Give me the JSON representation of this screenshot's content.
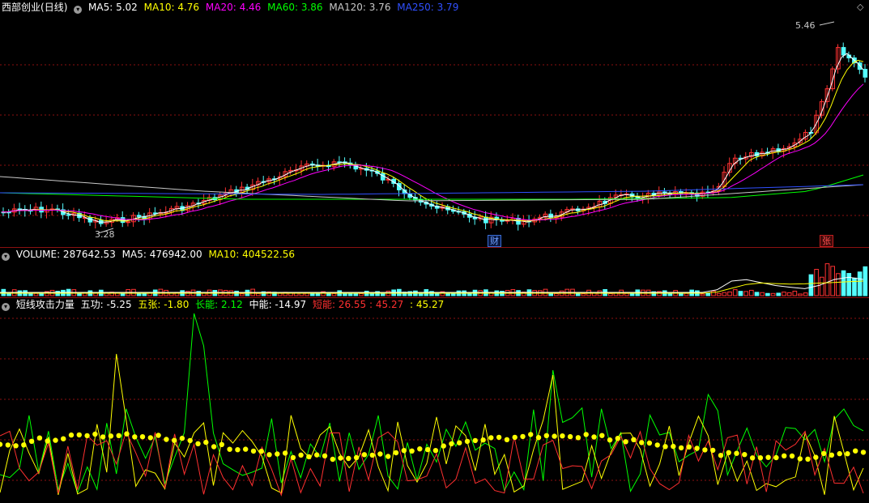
{
  "stock": {
    "name": "西部创业",
    "period": "(日线)"
  },
  "price_legend": [
    {
      "label": "MA5: 5.02",
      "color": "#ffffff"
    },
    {
      "label": "MA10: 4.76",
      "color": "#ffff00"
    },
    {
      "label": "MA20: 4.46",
      "color": "#ff00ff"
    },
    {
      "label": "MA60: 3.86",
      "color": "#00ff00"
    },
    {
      "label": "MA120: 3.76",
      "color": "#c8c8c8"
    },
    {
      "label": "MA250: 3.79",
      "color": "#3050ff"
    }
  ],
  "volume_legend": [
    {
      "label": "VOLUME: 287642.53",
      "color": "#ffffff"
    },
    {
      "label": "MA5: 476942.00",
      "color": "#ffffff"
    },
    {
      "label": "MA10: 404522.56",
      "color": "#ffff00"
    }
  ],
  "indicator_legend": [
    {
      "label": "短线攻击力量",
      "color": "#ffffff"
    },
    {
      "label": "五功: -5.25",
      "color": "#ffffff"
    },
    {
      "label": "五张: -1.80",
      "color": "#ffff00"
    },
    {
      "label": "长能: 2.12",
      "color": "#00ff00"
    },
    {
      "label": "中能: -14.97",
      "color": "#ffffff"
    },
    {
      "label": "短能: 26.55",
      "color": "#ff3030"
    },
    {
      "label": ": 45.27",
      "color": "#ff3030"
    },
    {
      "label": ": 45.27",
      "color": "#ffff00"
    }
  ],
  "annotations": {
    "high": "5.46",
    "low": "3.28"
  },
  "markers": {
    "cai": "财",
    "zhang": "张"
  },
  "icons": {
    "dropdown": "dropdown-icon",
    "corner": "diamond-icon"
  },
  "colors": {
    "up": "#ff3232",
    "down": "#54ffff",
    "grid": "#8b1010",
    "dots": "#ffff00"
  }
}
